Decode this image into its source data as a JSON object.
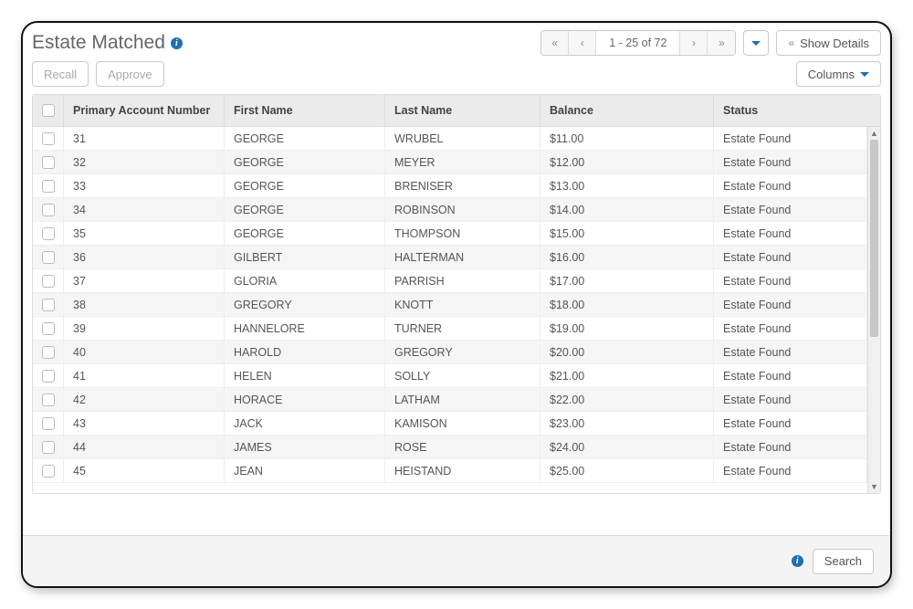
{
  "header": {
    "title": "Estate Matched",
    "show_details_label": "Show Details"
  },
  "pager": {
    "range_text": "1 - 25 of 72"
  },
  "actions": {
    "recall_label": "Recall",
    "approve_label": "Approve",
    "columns_label": "Columns"
  },
  "columns": {
    "primary_account_number": "Primary Account Number",
    "first_name": "First Name",
    "last_name": "Last Name",
    "balance": "Balance",
    "status": "Status"
  },
  "rows": [
    {
      "pan": "31",
      "first": "GEORGE",
      "last": "WRUBEL",
      "balance": "$11.00",
      "status": "Estate Found"
    },
    {
      "pan": "32",
      "first": "GEORGE",
      "last": "MEYER",
      "balance": "$12.00",
      "status": "Estate Found"
    },
    {
      "pan": "33",
      "first": "GEORGE",
      "last": "BRENISER",
      "balance": "$13.00",
      "status": "Estate Found"
    },
    {
      "pan": "34",
      "first": "GEORGE",
      "last": "ROBINSON",
      "balance": "$14.00",
      "status": "Estate Found"
    },
    {
      "pan": "35",
      "first": "GEORGE",
      "last": "THOMPSON",
      "balance": "$15.00",
      "status": "Estate Found"
    },
    {
      "pan": "36",
      "first": "GILBERT",
      "last": "HALTERMAN",
      "balance": "$16.00",
      "status": "Estate Found"
    },
    {
      "pan": "37",
      "first": "GLORIA",
      "last": "PARRISH",
      "balance": "$17.00",
      "status": "Estate Found"
    },
    {
      "pan": "38",
      "first": "GREGORY",
      "last": "KNOTT",
      "balance": "$18.00",
      "status": "Estate Found"
    },
    {
      "pan": "39",
      "first": "HANNELORE",
      "last": "TURNER",
      "balance": "$19.00",
      "status": "Estate Found"
    },
    {
      "pan": "40",
      "first": "HAROLD",
      "last": "GREGORY",
      "balance": "$20.00",
      "status": "Estate Found"
    },
    {
      "pan": "41",
      "first": "HELEN",
      "last": "SOLLY",
      "balance": "$21.00",
      "status": "Estate Found"
    },
    {
      "pan": "42",
      "first": "HORACE",
      "last": "LATHAM",
      "balance": "$22.00",
      "status": "Estate Found"
    },
    {
      "pan": "43",
      "first": "JACK",
      "last": "KAMISON",
      "balance": "$23.00",
      "status": "Estate Found"
    },
    {
      "pan": "44",
      "first": "JAMES",
      "last": "ROSE",
      "balance": "$24.00",
      "status": "Estate Found"
    },
    {
      "pan": "45",
      "first": "JEAN",
      "last": "HEISTAND",
      "balance": "$25.00",
      "status": "Estate Found"
    }
  ],
  "footer": {
    "search_label": "Search"
  }
}
